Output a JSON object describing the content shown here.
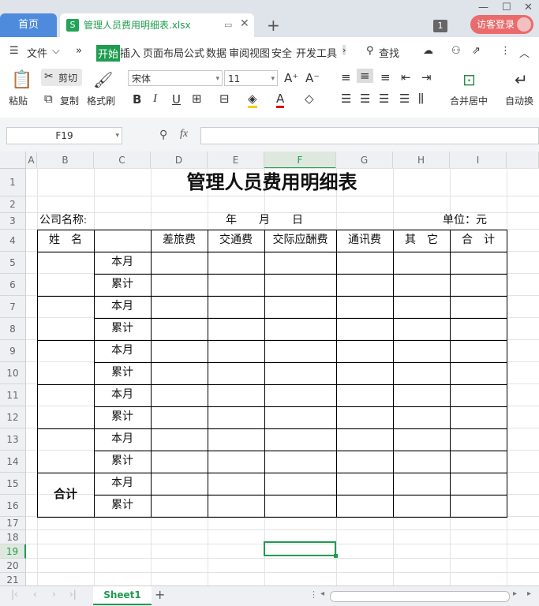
{
  "tabs": {
    "home": "首页",
    "file_icon": "S",
    "file_title": "管理人员费用明细表.xlsx",
    "new_tab": "+",
    "count_badge": "1",
    "login": "访客登录"
  },
  "menu": {
    "file": "文件",
    "items": [
      "开始",
      "插入",
      "页面布局",
      "公式",
      "数据",
      "审阅",
      "视图",
      "安全",
      "开发工具"
    ],
    "search": "查找"
  },
  "ribbon": {
    "paste": "粘贴",
    "cut": "剪切",
    "copy": "复制",
    "format_painter": "格式刷",
    "font_name": "宋体",
    "font_size": "11",
    "merge_center": "合并居中",
    "auto_wrap": "自动换"
  },
  "formula_bar": {
    "name_box": "F19",
    "fx": "fx"
  },
  "grid": {
    "columns": [
      "A",
      "B",
      "C",
      "D",
      "E",
      "F",
      "G",
      "H",
      "I"
    ],
    "rows": [
      "1",
      "2",
      "3",
      "4",
      "5",
      "6",
      "7",
      "8",
      "9",
      "10",
      "11",
      "12",
      "13",
      "14",
      "15",
      "16",
      "17",
      "18",
      "19",
      "20",
      "21"
    ],
    "active_column": "F",
    "active_row": "19"
  },
  "table": {
    "title": "管理人员费用明细表",
    "company": "公司名称:",
    "date": "年　　月　　日",
    "unit": "单位：元",
    "headers": [
      "姓　名",
      "",
      "差旅费",
      "交通费",
      "交际应酬费",
      "通讯费",
      "其　它",
      "合　计"
    ],
    "month": "本月",
    "cumulative": "累计",
    "total": "合计"
  },
  "sheets": {
    "active": "Sheet1",
    "add": "+"
  },
  "colors": {
    "accent": "#1e9c4f",
    "home_tab": "#4f8bdc",
    "login": "#e96b6b"
  }
}
